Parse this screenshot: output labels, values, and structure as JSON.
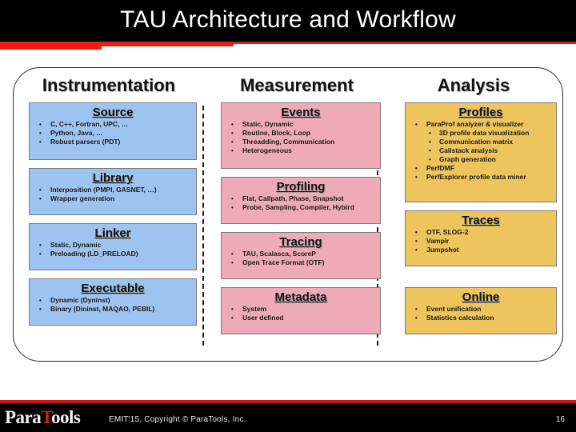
{
  "slide": {
    "title": "TAU Architecture and Workflow",
    "accent_red": "#d91f11",
    "header_bg": "#000000"
  },
  "columns": [
    {
      "header": "Instrumentation",
      "color": "#9dc3f0",
      "boxes": [
        {
          "title": "Source",
          "items": [
            {
              "text": "C, C++, Fortran, UPC, …"
            },
            {
              "text": "Python, Java, …"
            },
            {
              "text": "Robust parsers (PDT)"
            }
          ]
        },
        {
          "title": "Library",
          "items": [
            {
              "text": "Interposition (PMPI, GASNET, …)"
            },
            {
              "text": "Wrapper generation"
            }
          ]
        },
        {
          "title": "Linker",
          "items": [
            {
              "text": "Static, Dynamic"
            },
            {
              "text": "Preloading (LD_PRELOAD)"
            }
          ]
        },
        {
          "title": "Executable",
          "items": [
            {
              "text": "Dynamic (Dyninst)"
            },
            {
              "text": "Binary (Dininst, MAQAO, PEBIL)"
            }
          ]
        }
      ]
    },
    {
      "header": "Measurement",
      "color": "#eeaab8",
      "boxes": [
        {
          "title": "Events",
          "items": [
            {
              "text": "Static, Dynamic"
            },
            {
              "text": "Routine, Block, Loop"
            },
            {
              "text": "Threadding, Communication"
            },
            {
              "text": "Heterogeneous"
            }
          ]
        },
        {
          "title": "Profiling",
          "items": [
            {
              "text": "Flat, Callpath, Phase, Snapshot"
            },
            {
              "text": "Probe, Sampling, Compiler, Hybird"
            }
          ]
        },
        {
          "title": "Tracing",
          "items": [
            {
              "text": "TAU, Scalasca, ScoreP"
            },
            {
              "text": "Open Trace Format (OTF)"
            }
          ]
        },
        {
          "title": "Metadata",
          "items": [
            {
              "text": "System"
            },
            {
              "text": "User defined"
            }
          ]
        }
      ]
    },
    {
      "header": "Analysis",
      "color": "#eec45c",
      "boxes": [
        {
          "title": "Profiles",
          "items": [
            {
              "text": "ParaProf analyzer & visualizer",
              "children": [
                {
                  "text": "3D profile data visualization"
                },
                {
                  "text": "Communication matrix"
                },
                {
                  "text": "Callstack analysis"
                },
                {
                  "text": "Graph generation"
                }
              ]
            },
            {
              "text": "PerfDMF"
            },
            {
              "text": "PerfExplorer profile data miner"
            }
          ]
        },
        {
          "title": "Traces",
          "items": [
            {
              "text": "OTF, SLOG-2"
            },
            {
              "text": "Vampir"
            },
            {
              "text": "Jumpshot"
            }
          ]
        },
        {
          "title": "Online",
          "items": [
            {
              "text": "Event unification"
            },
            {
              "text": "Statistics calculation"
            }
          ]
        }
      ]
    }
  ],
  "footer": {
    "logo_pre": "Para",
    "logo_accent": "T",
    "logo_post": "ools",
    "copyright": "EMIT'15, Copyright © ParaTools, Inc.",
    "page_number": "16"
  }
}
